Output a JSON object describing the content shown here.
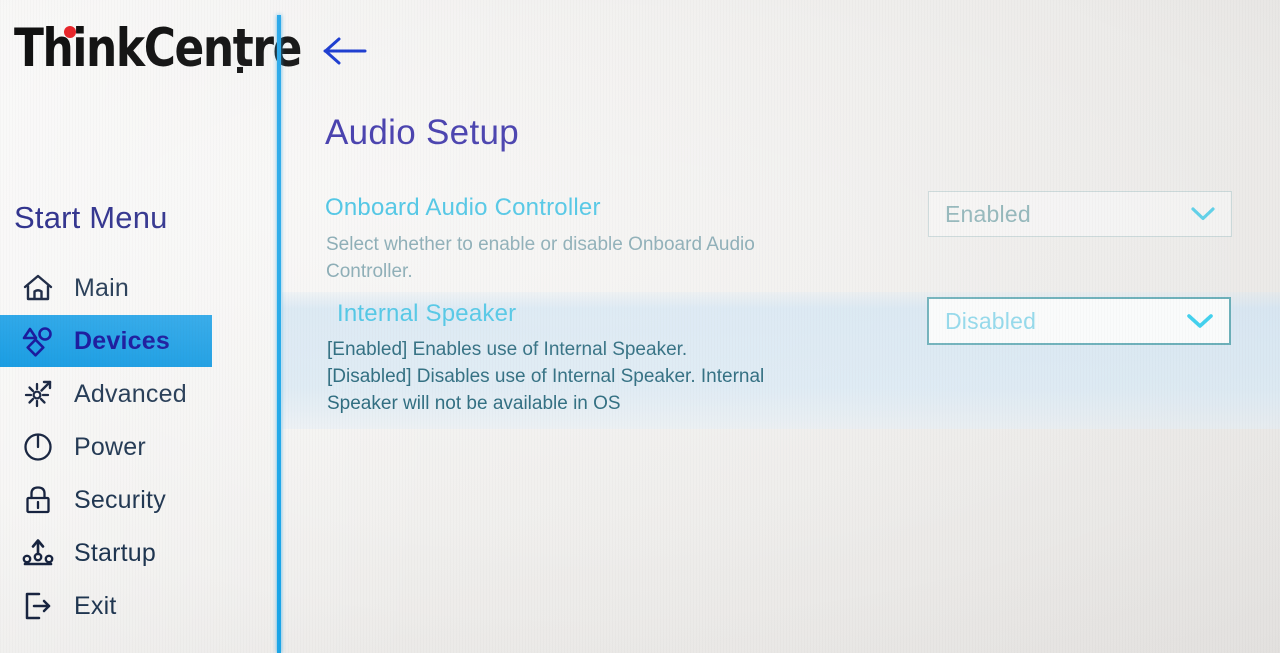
{
  "brand": {
    "logo_text": "ThinkCentre",
    "logo_dot_color": "#e8262b"
  },
  "sidebar": {
    "title": "Start Menu",
    "accent_color": "#1ba6e9",
    "items": [
      {
        "label": "Main",
        "icon": "home-icon",
        "selected": false
      },
      {
        "label": "Devices",
        "icon": "devices-icon",
        "selected": true
      },
      {
        "label": "Advanced",
        "icon": "advanced-icon",
        "selected": false
      },
      {
        "label": "Power",
        "icon": "power-icon",
        "selected": false
      },
      {
        "label": "Security",
        "icon": "lock-icon",
        "selected": false
      },
      {
        "label": "Startup",
        "icon": "startup-icon",
        "selected": false
      },
      {
        "label": "Exit",
        "icon": "exit-icon",
        "selected": false
      }
    ]
  },
  "main": {
    "back_icon": "back-arrow-icon",
    "page_title": "Audio Setup",
    "title_color": "#3a32a8",
    "settings": [
      {
        "name": "Onboard Audio Controller",
        "description": "Select whether to enable or disable Onboard Audio Controller.",
        "value": "Enabled",
        "highlighted": false,
        "chevron_icon": "chevron-down-icon"
      },
      {
        "name": "Internal Speaker",
        "description_line1": "[Enabled] Enables use of Internal Speaker.",
        "description_line2": "[Disabled] Disables use of Internal Speaker. Internal",
        "description_line3": "Speaker will not be available in OS",
        "value": "Disabled",
        "highlighted": true,
        "chevron_icon": "chevron-down-icon"
      }
    ]
  }
}
